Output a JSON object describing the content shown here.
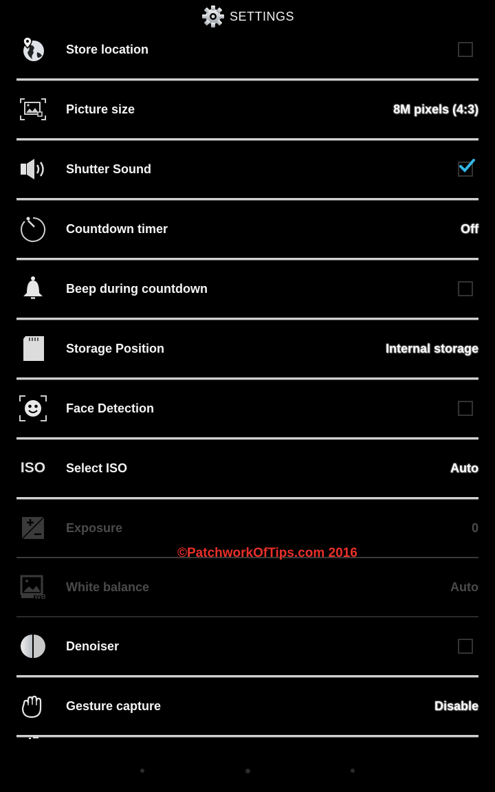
{
  "header": {
    "title": "SETTINGS",
    "icon": "gear-icon"
  },
  "settings": [
    {
      "label": "Store location",
      "icon": "globe-location-icon",
      "type": "checkbox",
      "checked": false,
      "enabled": true
    },
    {
      "label": "Picture size",
      "icon": "picture-size-icon",
      "type": "value",
      "value": "8M pixels (4:3)",
      "enabled": true
    },
    {
      "label": "Shutter Sound",
      "icon": "speaker-icon",
      "type": "checkbox",
      "checked": true,
      "enabled": true
    },
    {
      "label": "Countdown timer",
      "icon": "timer-icon",
      "type": "value",
      "value": "Off",
      "enabled": true
    },
    {
      "label": "Beep during countdown",
      "icon": "bell-icon",
      "type": "checkbox",
      "checked": false,
      "enabled": true
    },
    {
      "label": "Storage Position",
      "icon": "sd-card-icon",
      "type": "value",
      "value": "Internal storage",
      "enabled": true
    },
    {
      "label": "Face Detection",
      "icon": "face-detection-icon",
      "type": "checkbox",
      "checked": false,
      "enabled": true
    },
    {
      "label": "Select ISO",
      "icon": "iso-icon",
      "icon_text": "ISO",
      "type": "value",
      "value": "Auto",
      "enabled": true
    },
    {
      "label": "Exposure",
      "icon": "exposure-icon",
      "type": "value",
      "value": "0",
      "enabled": false
    },
    {
      "label": "White balance",
      "icon": "white-balance-icon",
      "icon_text": "WB",
      "type": "value",
      "value": "Auto",
      "enabled": false
    },
    {
      "label": "Denoiser",
      "icon": "denoiser-icon",
      "type": "checkbox",
      "checked": false,
      "enabled": true
    },
    {
      "label": "Gesture capture",
      "icon": "hand-icon",
      "type": "value",
      "value": "Disable",
      "enabled": true
    }
  ],
  "watermark": "©PatchworkOfTips.com 2016",
  "colors": {
    "accent_check": "#33b5e5",
    "watermark": "#e8302a"
  },
  "page_indicator": {
    "count": 3,
    "active": 1
  }
}
